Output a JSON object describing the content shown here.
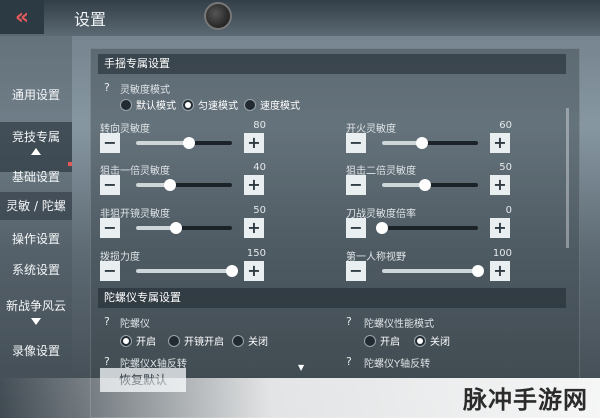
{
  "header": {
    "back_icon": "double-chevron-left-icon",
    "title": "设置"
  },
  "sidebar": {
    "items": [
      {
        "label": "通用设置"
      },
      {
        "label": "竞技专属"
      },
      {
        "label": "基础设置"
      },
      {
        "label": "灵敏 / 陀螺"
      },
      {
        "label": "操作设置"
      },
      {
        "label": "系统设置"
      },
      {
        "label": "新战争风云"
      },
      {
        "label": "录像设置"
      }
    ]
  },
  "touch_section": {
    "title": "手揺专属设置",
    "help": "?",
    "mode_label": "灵敏度模式",
    "modes": [
      {
        "label": "默认模式",
        "selected": false
      },
      {
        "label": "匀速模式",
        "selected": true
      },
      {
        "label": "速度模式",
        "selected": false
      }
    ],
    "sliders": [
      {
        "label": "转向灵敏度",
        "value": "80",
        "level": 0.55
      },
      {
        "label": "开火灵敏度",
        "value": "60",
        "level": 0.42
      },
      {
        "label": "狙击一倍灵敏度",
        "value": "40",
        "level": 0.35
      },
      {
        "label": "狙击二倍灵敏度",
        "value": "50",
        "level": 0.45
      },
      {
        "label": "非狙开镜灵敏度",
        "value": "50",
        "level": 0.42
      },
      {
        "label": "刀战灵敏度倍率",
        "value": "0",
        "level": 0.0
      },
      {
        "label": "拨损力度",
        "value": "150",
        "level": 1.0
      },
      {
        "label": "第一人称视野",
        "value": "100",
        "level": 1.0
      }
    ],
    "minus": "−",
    "plus": "+"
  },
  "gyro_section": {
    "title": "陀螺仪专属设置",
    "help": "?",
    "gyro_label": "陀螺仪",
    "gyro_options": [
      {
        "label": "开启",
        "selected": true
      },
      {
        "label": "开镜开启",
        "selected": false
      },
      {
        "label": "关闭",
        "selected": false
      }
    ],
    "perf_label": "陀螺仪性能模式",
    "perf_options": [
      {
        "label": "开启",
        "selected": false
      },
      {
        "label": "关闭",
        "selected": true
      }
    ],
    "x_invert_label": "陀螺仪X轴反转",
    "y_invert_label": "陀螺仪Y轴反转"
  },
  "footer": {
    "reset_label": "恢复默认"
  },
  "watermark": "脉冲手游网",
  "colors": {
    "accent_red": "#e35a5a",
    "button_bg": "#e9eef0"
  }
}
